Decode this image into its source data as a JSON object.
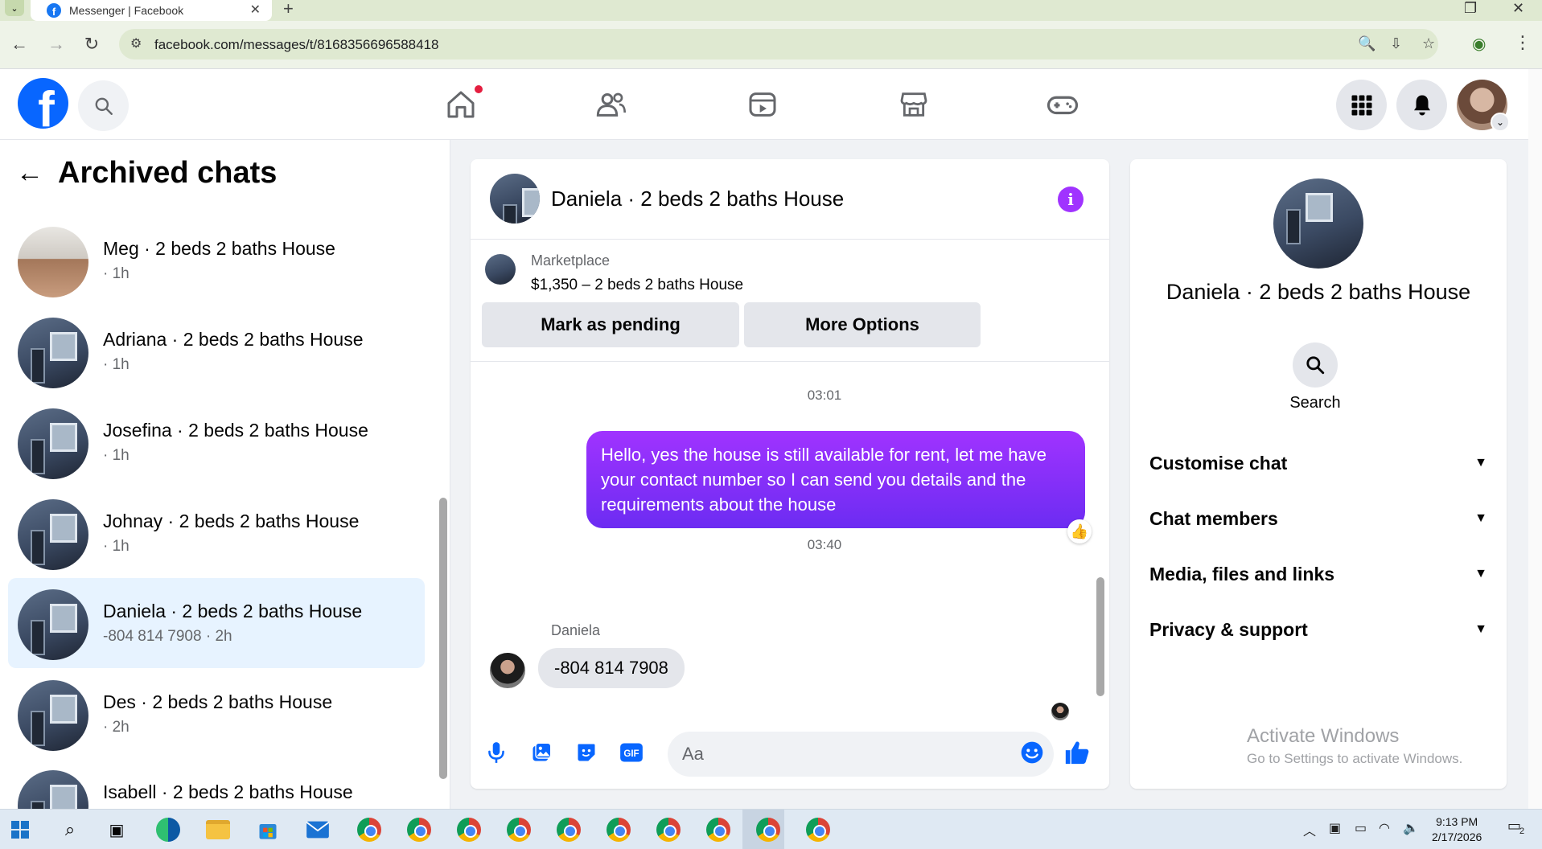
{
  "browser": {
    "tab_title": "Messenger | Facebook",
    "url": "facebook.com/messages/t/8168356696588418"
  },
  "left": {
    "title": "Archived chats",
    "chats": [
      {
        "name": "Meg · 2 beds 2 baths House",
        "sub": "· 1h",
        "thumb": "kitchen"
      },
      {
        "name": "Adriana · 2 beds 2 baths House",
        "sub": "· 1h",
        "thumb": "house"
      },
      {
        "name": "Josefina · 2 beds 2 baths House",
        "sub": "· 1h",
        "thumb": "house"
      },
      {
        "name": "Johnay · 2 beds 2 baths House",
        "sub": "· 1h",
        "thumb": "house"
      },
      {
        "name": "Daniela · 2 beds 2 baths House",
        "sub": "-804 814 7908 · 2h",
        "thumb": "house",
        "active": true
      },
      {
        "name": "Des · 2 beds 2 baths House",
        "sub": "· 2h",
        "thumb": "house"
      },
      {
        "name": "Isabell · 2 beds 2 baths House",
        "sub": "",
        "thumb": "house"
      }
    ]
  },
  "conversation": {
    "title": "Daniela · 2 beds 2 baths House",
    "marketplace_label": "Marketplace",
    "listing": "$1,350 – 2 beds 2 baths House",
    "btn_pending": "Mark as pending",
    "btn_more": "More Options",
    "time1": "03:01",
    "outgoing": "Hello, yes the house is still available for rent, let me have your contact number so I can send you details and the requirements about the house",
    "time2": "03:40",
    "sender": "Daniela",
    "incoming": "-804 814 7908",
    "composer_placeholder": "Aa"
  },
  "details": {
    "name": "Daniela · 2 beds 2 baths House",
    "search_label": "Search",
    "sections": [
      "Customise chat",
      "Chat members",
      "Media, files and links",
      "Privacy & support"
    ]
  },
  "watermark": {
    "line1": "Activate Windows",
    "line2": "Go to Settings to activate Windows."
  },
  "taskbar": {
    "time": "9:13 PM",
    "date": "2/17/2026",
    "notif_count": "2"
  },
  "colors": {
    "fb_blue": "#0866ff",
    "messenger_purple": "#a033ff",
    "active_chat_bg": "#e7f3ff"
  }
}
